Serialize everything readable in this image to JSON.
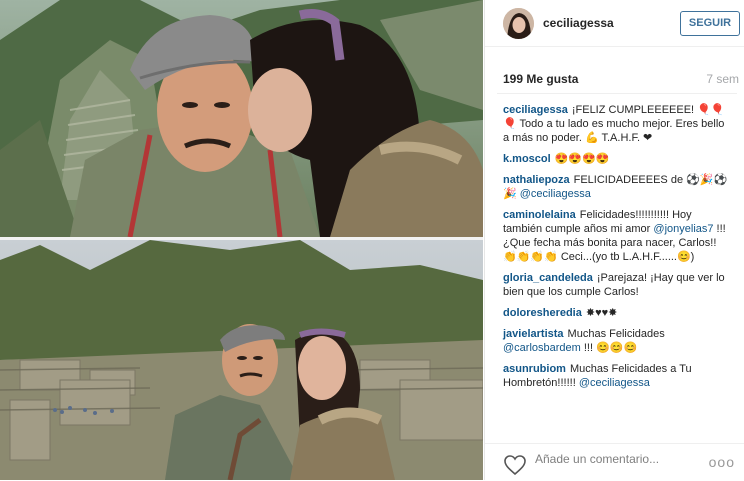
{
  "header": {
    "username": "ceciliagessa",
    "follow_label": "SEGUIR"
  },
  "post": {
    "likes": "199 Me gusta",
    "age": "7 sem"
  },
  "comments": [
    {
      "user": "ceciliagessa",
      "text": "¡FELIZ CUMPLEEEEEE! 🎈🎈🎈 Todo a tu lado es mucho mejor. Eres bello a más no poder. 💪 T.A.H.F. ❤"
    },
    {
      "user": "k.moscol",
      "text": "😍😍😍😍"
    },
    {
      "user": "nathaliepoza",
      "text": "FELICIDADEEEES de ⚽🎉⚽🎉 ",
      "mention": "@ceciliagessa"
    },
    {
      "user": "caminolelaina",
      "text": "Felicidades!!!!!!!!!!! Hoy también cumple años mi amor ",
      "mention": "@jonyelias7",
      "text2": " !!!¿Que fecha más bonita para nacer, Carlos!! 👏👏👏👏 Ceci...(yo tb L.A.H.F......😊)"
    },
    {
      "user": "gloria_candeleda",
      "text": "¡Parejaza! ¡Hay que ver lo bien que los cumple Carlos!"
    },
    {
      "user": "doloresheredia",
      "text": "✸♥♥✸"
    },
    {
      "user": "javielartista",
      "text": "Muchas Felicidades ",
      "mention": "@carlosbardem",
      "text2": " !!! 😊😊😊"
    },
    {
      "user": "asunrubiom",
      "text": "Muchas Felicidades a Tu Hombretón!!!!!! ",
      "mention": "@ceciliagessa"
    }
  ],
  "add_comment": {
    "placeholder": "Añade un comentario...",
    "more": "ooo"
  },
  "colors": {
    "link": "#125688",
    "follow_border": "#3f729b",
    "muted": "#a5a7aa"
  }
}
